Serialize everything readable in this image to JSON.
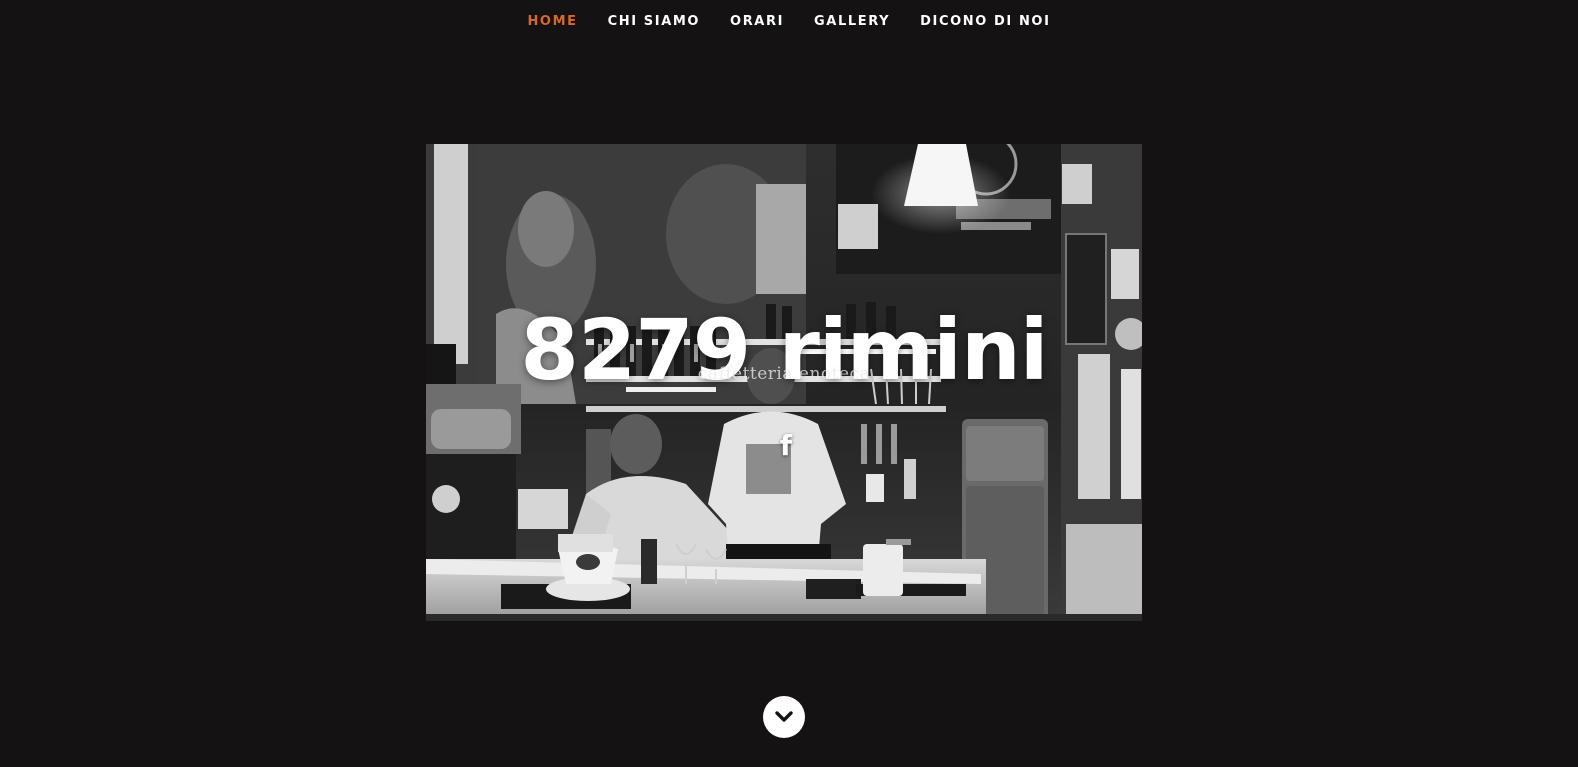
{
  "nav": {
    "items": [
      {
        "label": "HOME",
        "active": true
      },
      {
        "label": "CHI SIAMO",
        "active": false
      },
      {
        "label": "ORARI",
        "active": false
      },
      {
        "label": "GALLERY",
        "active": false
      },
      {
        "label": "DICONO DI NOI",
        "active": false
      }
    ]
  },
  "hero": {
    "title": "8279 rimini",
    "subtitle": "caffetteria enoteca",
    "social_icon": "facebook-icon",
    "social_label": "f"
  },
  "scroll": {
    "icon": "chevron-down-icon"
  },
  "colors": {
    "background": "#141213",
    "nav_active": "#d9662b",
    "nav_text": "#ffffff"
  }
}
